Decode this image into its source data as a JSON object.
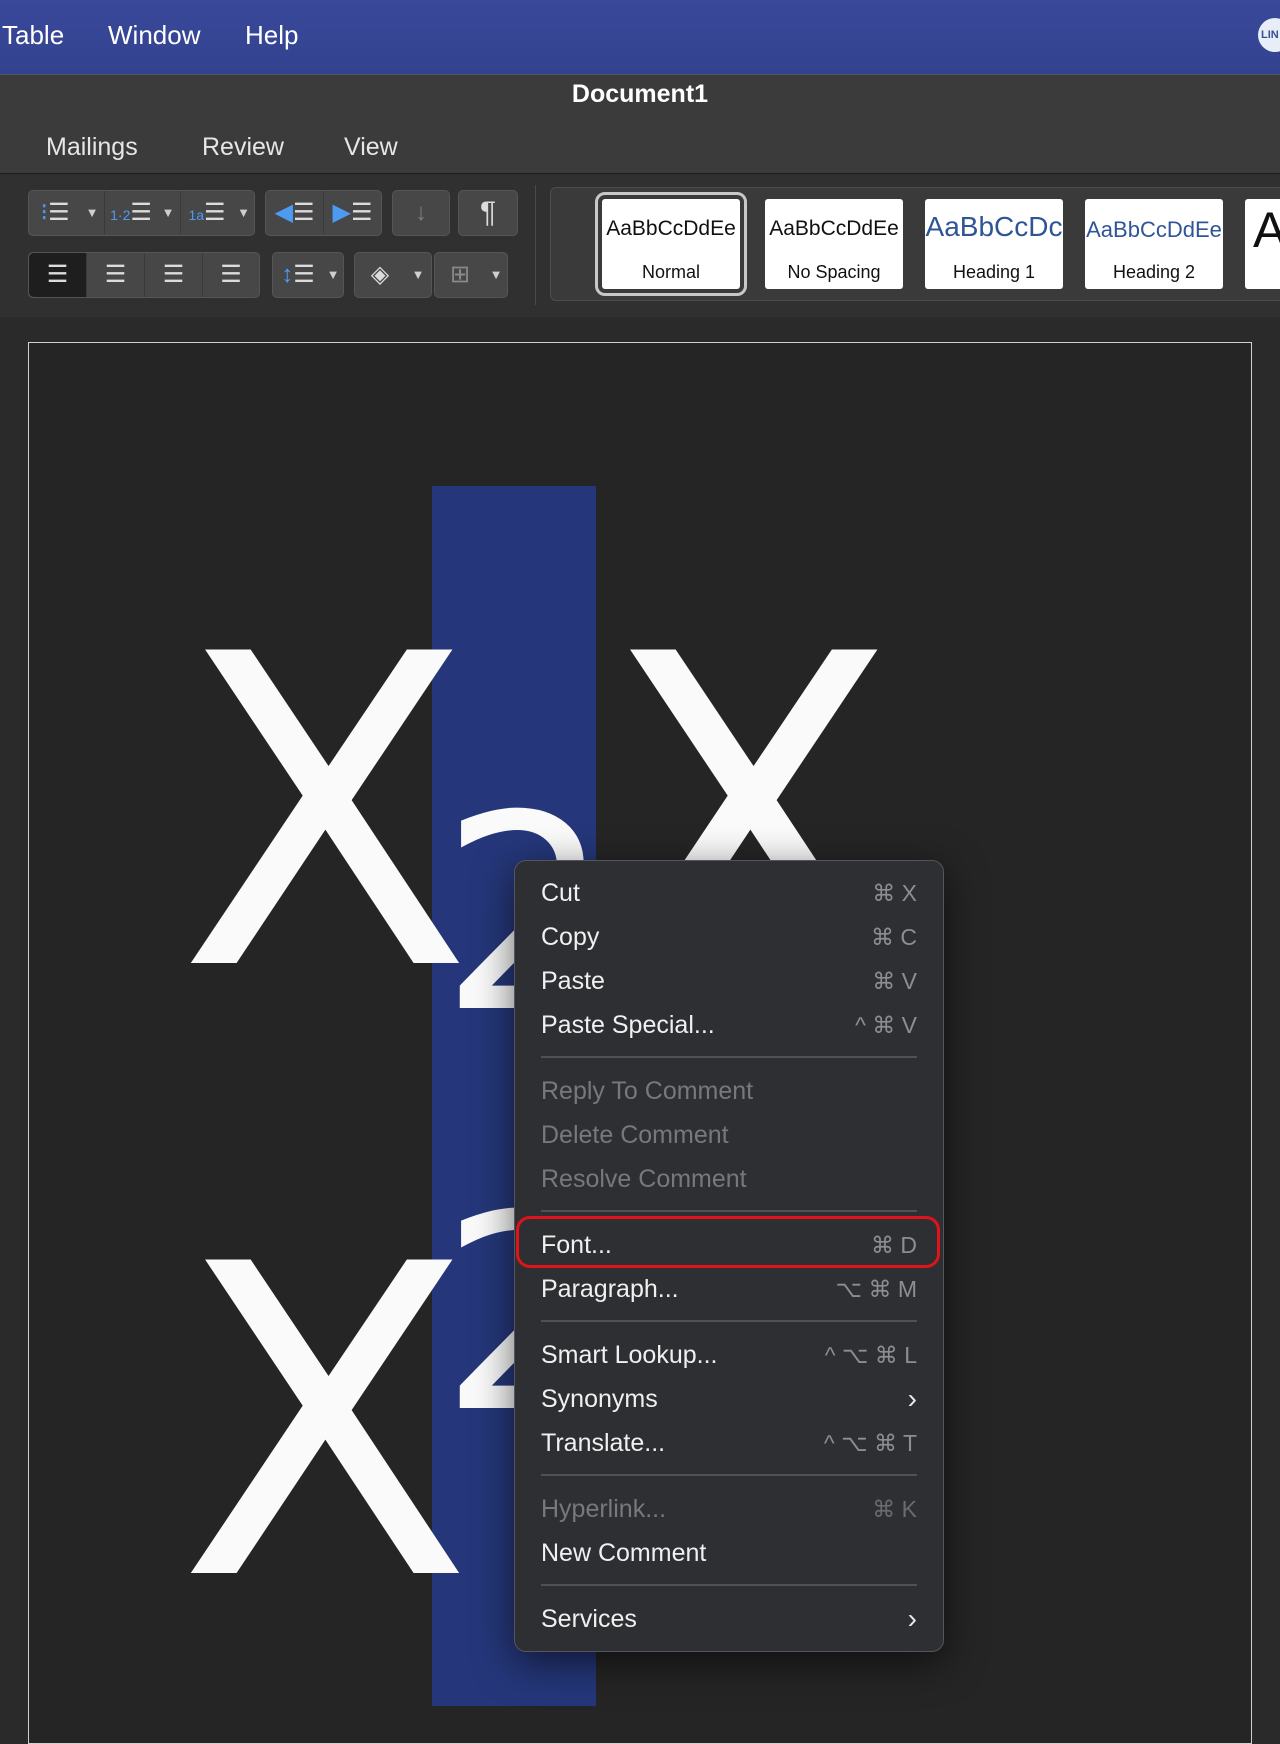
{
  "menubar": {
    "items": [
      "Table",
      "Window",
      "Help"
    ],
    "tray_icon": "line-app-icon",
    "tray_text": "LIN"
  },
  "window": {
    "title": "Document1"
  },
  "ribbon": {
    "tabs": [
      "Mailings",
      "Review",
      "View"
    ],
    "styles": [
      {
        "sample": "AaBbCcDdEe",
        "name": "Normal",
        "selected": true
      },
      {
        "sample": "AaBbCcDdEe",
        "name": "No Spacing"
      },
      {
        "sample": "AaBbCcDc",
        "name": "Heading 1"
      },
      {
        "sample": "AaBbCcDdEe",
        "name": "Heading 2"
      },
      {
        "sample": "A",
        "name": ""
      }
    ],
    "icons": [
      "bullets-icon",
      "numbering-icon",
      "multilevel-list-icon",
      "decrease-indent-icon",
      "increase-indent-icon",
      "sort-icon",
      "pilcrow-icon",
      "align-left-icon",
      "align-center-icon",
      "align-right-icon",
      "justify-icon",
      "line-spacing-icon",
      "shading-icon",
      "borders-icon"
    ]
  },
  "document": {
    "big_letter": "X",
    "subscript": "2",
    "highlight_color": "#25377a"
  },
  "context_menu": {
    "items": [
      {
        "label": "Cut",
        "shortcut": "⌘ X"
      },
      {
        "label": "Copy",
        "shortcut": "⌘ C"
      },
      {
        "label": "Paste",
        "shortcut": "⌘ V"
      },
      {
        "label": "Paste Special...",
        "shortcut": "^ ⌘ V"
      },
      {
        "label": "Reply To Comment",
        "disabled": true
      },
      {
        "label": "Delete Comment",
        "disabled": true
      },
      {
        "label": "Resolve Comment",
        "disabled": true
      },
      {
        "label": "Font...",
        "shortcut": "⌘ D",
        "highlighted": true
      },
      {
        "label": "Paragraph...",
        "shortcut": "⌥ ⌘ M"
      },
      {
        "label": "Smart Lookup...",
        "shortcut": "^ ⌥ ⌘ L"
      },
      {
        "label": "Synonyms",
        "submenu": true
      },
      {
        "label": "Translate...",
        "shortcut": "^ ⌥ ⌘ T"
      },
      {
        "label": "Hyperlink...",
        "shortcut": "⌘ K",
        "disabled": true
      },
      {
        "label": "New Comment"
      },
      {
        "label": "Services",
        "submenu": true
      }
    ],
    "highlight_ring_color": "#e0131b"
  }
}
